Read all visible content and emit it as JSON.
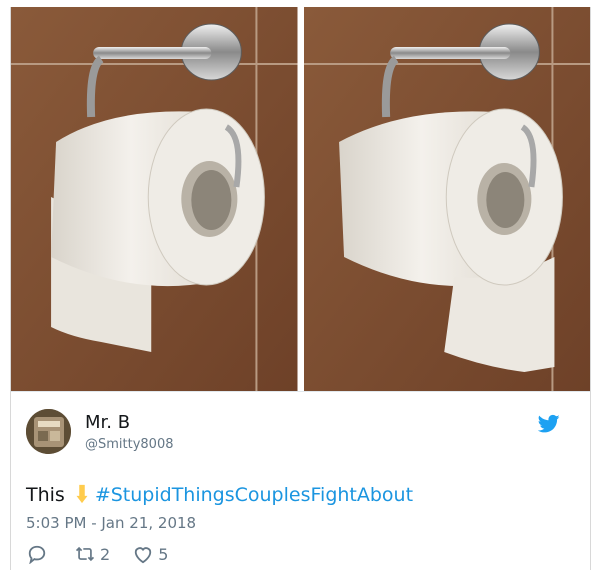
{
  "tweet": {
    "display_name": "Mr. B",
    "handle": "@Smitty8008",
    "text_prefix": "This",
    "emoji_icon": "pointing-down-hand-icon",
    "hashtag": "#StupidThingsCouplesFightAbout",
    "timestamp": "5:03 PM - Jan 21, 2018",
    "retweets": "2",
    "likes": "5"
  },
  "photos": [
    {
      "icon": "toilet-paper-under-photo"
    },
    {
      "icon": "toilet-paper-over-photo"
    }
  ],
  "colors": {
    "accent": "#1b95e0",
    "twitter_blue": "#1da1f2",
    "text": "#14171a",
    "muted": "#657786",
    "wall": "#8b5a3c"
  }
}
